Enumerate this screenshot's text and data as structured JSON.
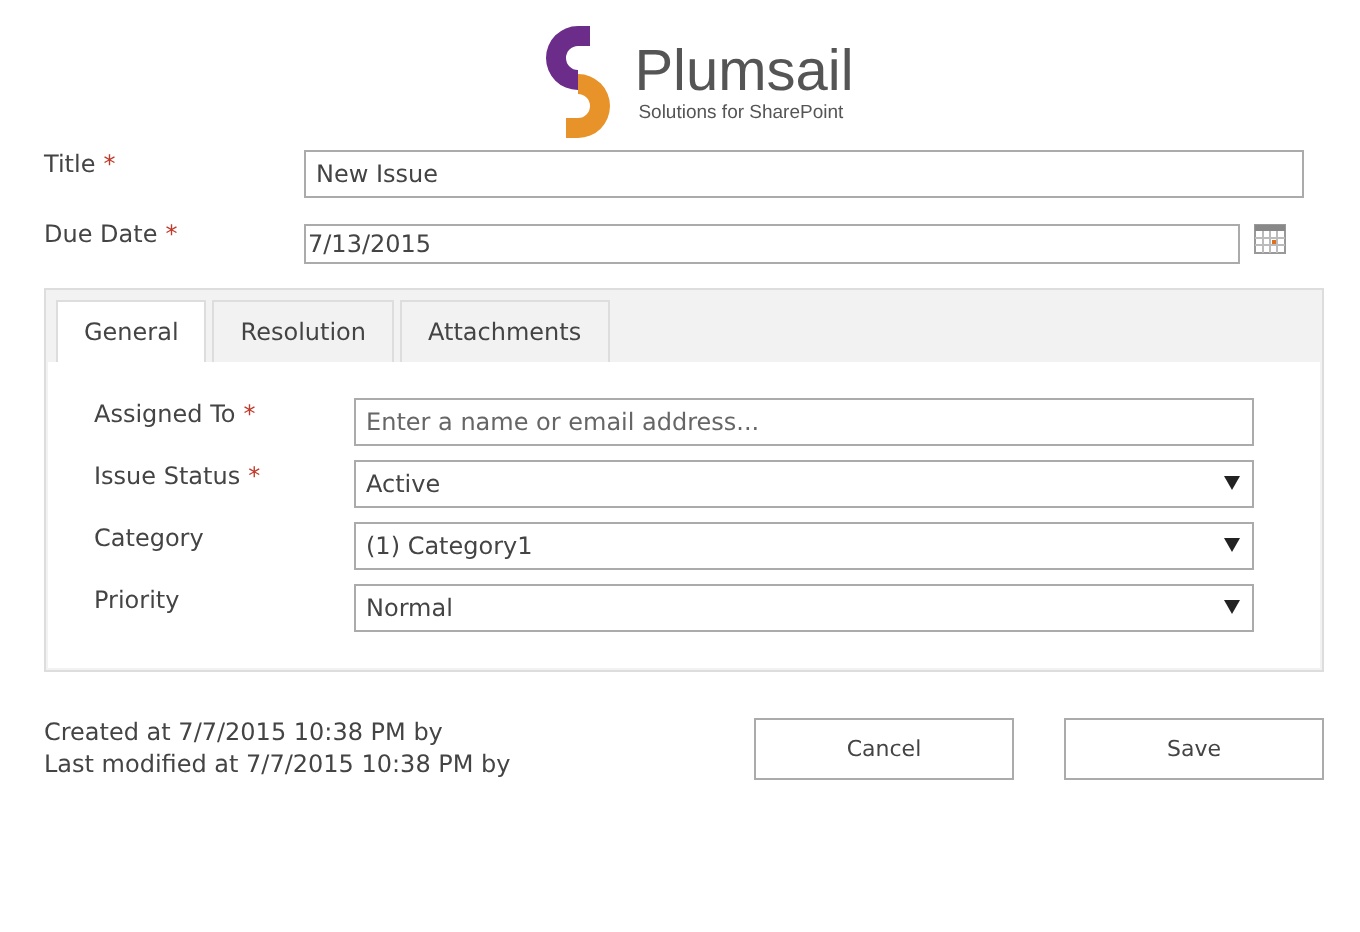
{
  "logo": {
    "name": "Plumsail",
    "tagline": "Solutions for SharePoint"
  },
  "fields": [
    {
      "label": "Title",
      "required_mark": "*",
      "kind": "text",
      "value": "New Issue"
    },
    {
      "label": "Due Date",
      "required_mark": "*",
      "kind": "date",
      "value": "7/13/2015"
    }
  ],
  "tabs": [
    {
      "label": "General",
      "selected": true
    },
    {
      "label": "Resolution",
      "selected": false
    },
    {
      "label": "Attachments",
      "selected": false
    }
  ],
  "tab_fields": [
    {
      "label": "Assigned To",
      "required_mark": "*",
      "kind": "text",
      "placeholder": "Enter a name or email address..."
    },
    {
      "label": "Issue Status",
      "required_mark": "*",
      "kind": "select",
      "value": "Active"
    },
    {
      "label": "Category",
      "kind": "select",
      "value": "(1) Category1"
    },
    {
      "label": "Priority",
      "kind": "select",
      "value": "Normal"
    }
  ],
  "footer": {
    "created": "Created at 7/7/2015 10:38 PM by",
    "modified": "Last modified at 7/7/2015 10:38 PM by"
  },
  "buttons": [
    "Cancel",
    "Save"
  ]
}
